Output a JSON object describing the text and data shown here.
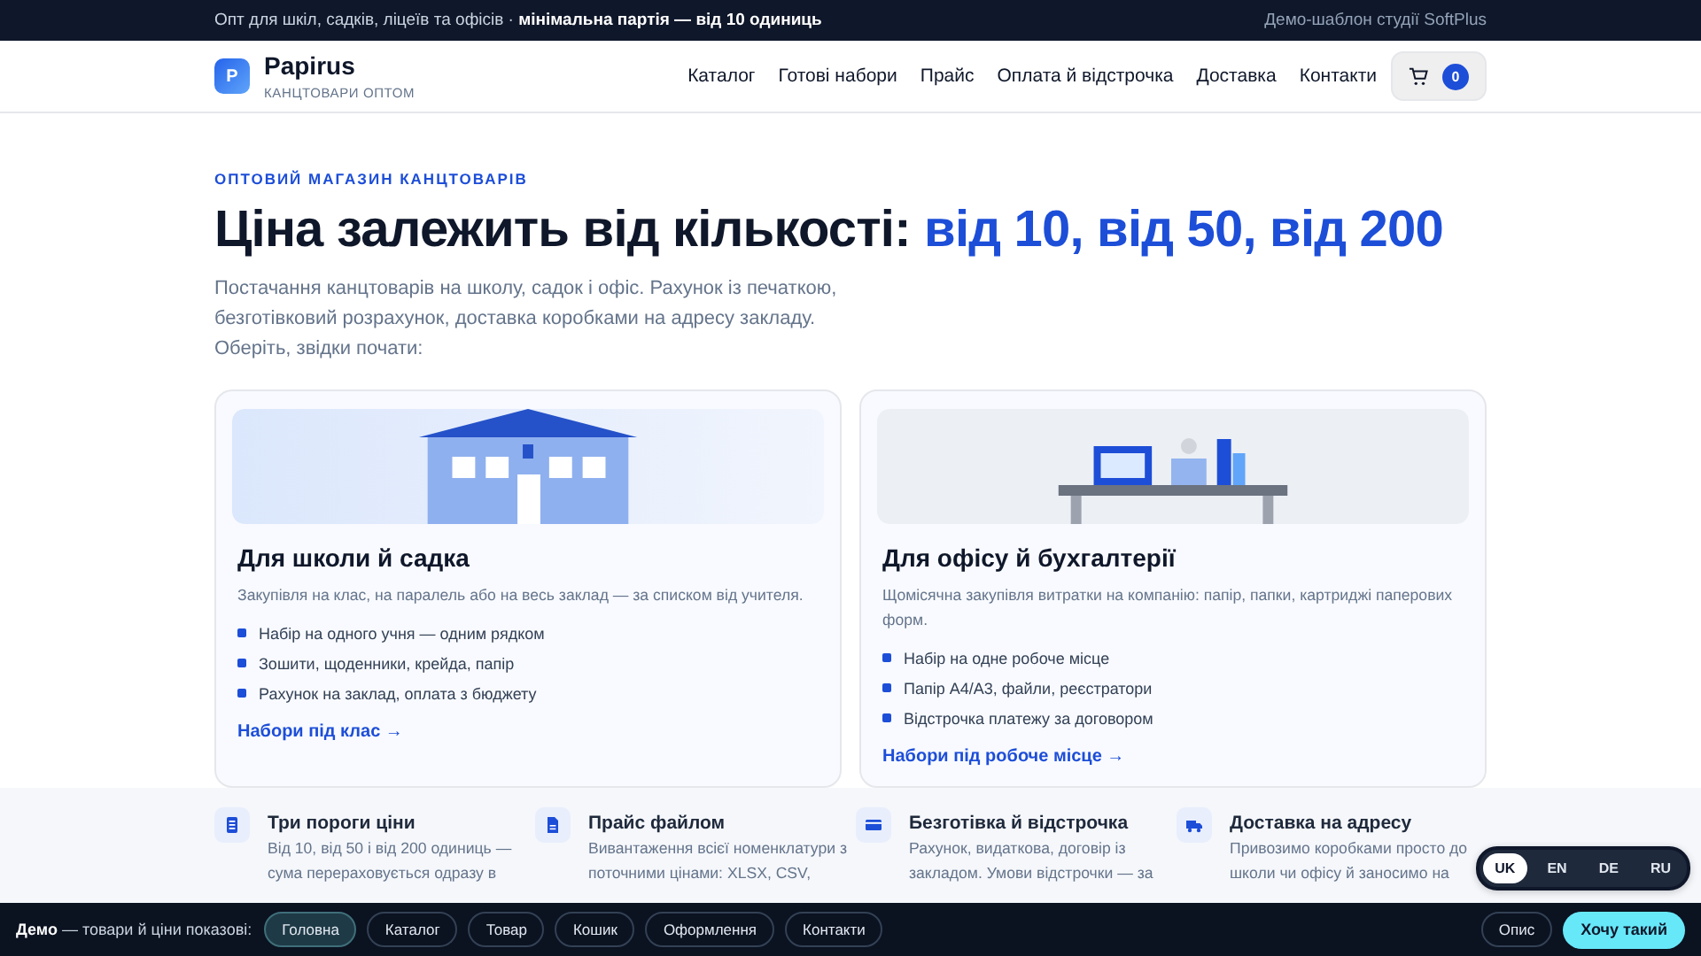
{
  "topbar": {
    "text": "Опт для шкіл, садків, ліцеїв та офісів · **мінімальна партія — від 10 одиниць**",
    "credit": "Демо-шаблон студії SoftPlus"
  },
  "header": {
    "logo_letter": "P",
    "brand": "Papirus",
    "tagline": "КАНЦТОВАРИ ОПТОМ",
    "nav": [
      "Каталог",
      "Готові набори",
      "Прайс",
      "Оплата й відстрочка",
      "Доставка",
      "Контакти"
    ],
    "cart_count": "0"
  },
  "hero": {
    "eyebrow": "ОПТОВИЙ МАГАЗИН КАНЦТОВАРІВ",
    "title": "Ціна залежить від кількості:",
    "title_accent": "від 10, від 50, від 200",
    "lead": "Постачання канцтоварів на школу, садок і офіс. Рахунок із печаткою, безготівковий розрахунок, доставка коробками на адресу закладу.",
    "prompt": "Оберіть, звідки почати:"
  },
  "cards": [
    {
      "kind": "school",
      "title": "Для школи й садка",
      "text": "Закупівля на клас, на паралель або на весь заклад — за списком від учителя.",
      "points": [
        "Набір на одного учня — одним рядком",
        "Зошити, щоденники, крейда, папір",
        "Рахунок на заклад, оплата з бюджету"
      ],
      "link": "Набори під клас →"
    },
    {
      "kind": "office",
      "title": "Для офісу й бухгалтерії",
      "text": "Щомісячна закупівля витратки на компанію: папір, папки, картриджі паперових форм.",
      "points": [
        "Набір на одне робоче місце",
        "Папір А4/А3, файли, реєстратори",
        "Відстрочка платежу за договором"
      ],
      "link": "Набори під робоче місце →"
    }
  ],
  "features": [
    {
      "kind": "tiers",
      "title": "Три пороги ціни",
      "text": "Від 10, від 50 і від 200 одиниць — сума перераховується одразу в"
    },
    {
      "kind": "file",
      "title": "Прайс файлом",
      "text": "Вивантаження всієї номенклатури з поточними цінами: XLSX, CSV,"
    },
    {
      "kind": "card",
      "title": "Безготівка й відстрочка",
      "text": "Рахунок, видаткова, договір із закладом. Умови відстрочки — за"
    },
    {
      "kind": "truck",
      "title": "Доставка на адресу",
      "text": "Привозимо коробками просто до школи чи офісу й заносимо на"
    }
  ],
  "languages": [
    {
      "label": "UK",
      "selected": true
    },
    {
      "label": "EN",
      "selected": false
    },
    {
      "label": "DE",
      "selected": false
    },
    {
      "label": "RU",
      "selected": false
    }
  ],
  "demo_bar": {
    "label": "**Демо** — товари й ціни показові:",
    "pages": [
      {
        "label": "Головна",
        "selected": true
      },
      {
        "label": "Каталог",
        "selected": false
      },
      {
        "label": "Товар",
        "selected": false
      },
      {
        "label": "Кошик",
        "selected": false
      },
      {
        "label": "Оформлення",
        "selected": false
      },
      {
        "label": "Контакти",
        "selected": false
      }
    ],
    "about": "Опис",
    "cta": "Хочу такий"
  }
}
